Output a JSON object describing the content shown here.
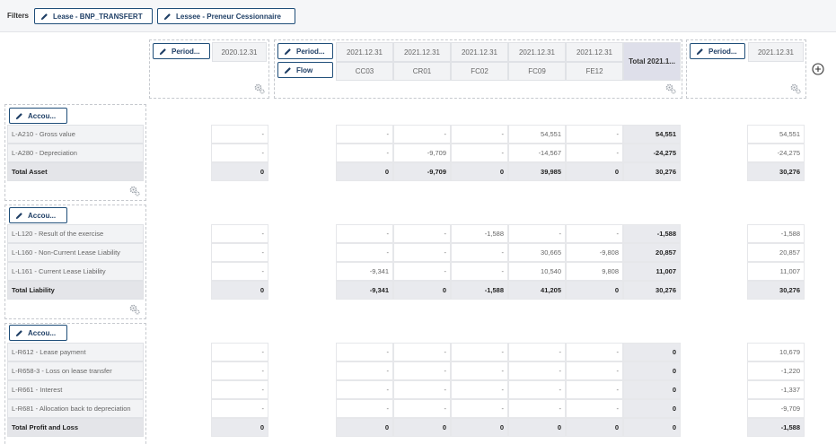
{
  "filters": {
    "label": "Filters",
    "items": [
      "Lease - BNP_TRANSFERT",
      "Lessee - Preneur Cessionnaire"
    ]
  },
  "headers": {
    "period_button": "Period...",
    "flow_button": "Flow",
    "account_button": "Accou...",
    "zone1_period": "2020.12.31",
    "zone2_periods": [
      "2021.12.31",
      "2021.12.31",
      "2021.12.31",
      "2021.12.31",
      "2021.12.31"
    ],
    "zone2_flows": [
      "CC03",
      "CR01",
      "FC02",
      "FC09",
      "FE12"
    ],
    "zone2_total": "Total 2021.1...",
    "zone3_period": "2021.12.31"
  },
  "sections": [
    {
      "rows": [
        {
          "label": "L-A210 - Gross value",
          "c1": "-",
          "vals": [
            "-",
            "-",
            "-",
            "54,551",
            "-"
          ],
          "total": "54,551",
          "c3": "54,551"
        },
        {
          "label": "L-A280 - Depreciation",
          "c1": "-",
          "vals": [
            "-",
            "-9,709",
            "-",
            "-14,567",
            "-"
          ],
          "total": "-24,275",
          "c3": "-24,275"
        }
      ],
      "totalrow": {
        "label": "Total Asset",
        "c1": "0",
        "vals": [
          "0",
          "-9,709",
          "0",
          "39,985",
          "0"
        ],
        "total": "30,276",
        "c3": "30,276"
      }
    },
    {
      "rows": [
        {
          "label": "L-L120 - Result of the exercise",
          "c1": "-",
          "vals": [
            "-",
            "-",
            "-1,588",
            "-",
            "-"
          ],
          "total": "-1,588",
          "c3": "-1,588"
        },
        {
          "label": "L-L160 - Non-Current Lease Liability",
          "c1": "-",
          "vals": [
            "-",
            "-",
            "-",
            "30,665",
            "-9,808"
          ],
          "total": "20,857",
          "c3": "20,857"
        },
        {
          "label": "L-L161 - Current Lease Liability",
          "c1": "-",
          "vals": [
            "-9,341",
            "-",
            "-",
            "10,540",
            "9,808"
          ],
          "total": "11,007",
          "c3": "11,007"
        }
      ],
      "totalrow": {
        "label": "Total Liability",
        "c1": "0",
        "vals": [
          "-9,341",
          "0",
          "-1,588",
          "41,205",
          "0"
        ],
        "total": "30,276",
        "c3": "30,276"
      }
    },
    {
      "rows": [
        {
          "label": "L-R612 - Lease payment",
          "c1": "-",
          "vals": [
            "-",
            "-",
            "-",
            "-",
            "-"
          ],
          "total": "0",
          "c3": "10,679"
        },
        {
          "label": "L-R658-3 - Loss on lease transfer",
          "c1": "-",
          "vals": [
            "-",
            "-",
            "-",
            "-",
            "-"
          ],
          "total": "0",
          "c3": "-1,220"
        },
        {
          "label": "L-R661 - Interest",
          "c1": "-",
          "vals": [
            "-",
            "-",
            "-",
            "-",
            "-"
          ],
          "total": "0",
          "c3": "-1,337"
        },
        {
          "label": "L-R681 - Allocation back to depreciation",
          "c1": "-",
          "vals": [
            "-",
            "-",
            "-",
            "-",
            "-"
          ],
          "total": "0",
          "c3": "-9,709"
        }
      ],
      "totalrow": {
        "label": "Total Profit and Loss",
        "c1": "0",
        "vals": [
          "0",
          "0",
          "0",
          "0",
          "0"
        ],
        "total": "0",
        "c3": "-1,588"
      }
    }
  ]
}
